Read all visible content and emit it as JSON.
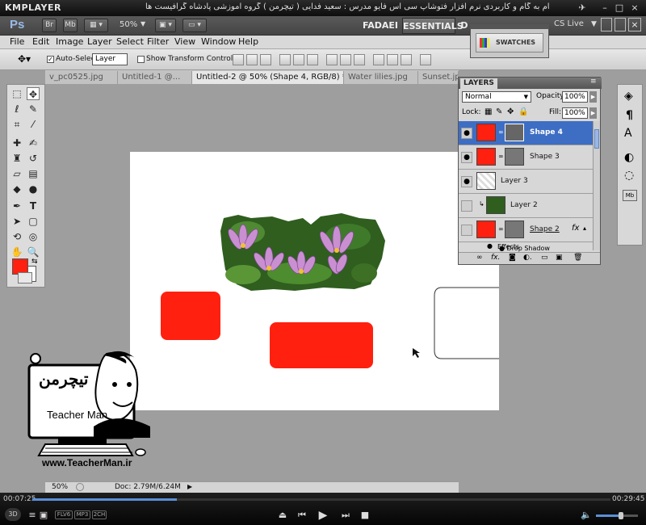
{
  "km_title": {
    "logo": "KMPLAYER",
    "text": "مجموعه آموزشی جامع ، گام به گام و کاربردی نرم افزار فتوشاپ سی اس فایو  مدرس : سعید فدایی ( تیچرمن ) گروه آموزشی پادشاه گرافیست ها",
    "pin": "✈",
    "minimize": "–",
    "maximize": "□",
    "close": "×"
  },
  "appbar": {
    "logo": "Ps",
    "br": "Br",
    "mb": "Mb",
    "zoom": "50%",
    "workspaces": [
      "FADAEI",
      "ESSENTIALS",
      "D"
    ],
    "cs_live": "CS Live"
  },
  "menu": [
    "File",
    "Edit",
    "Image",
    "Layer",
    "Select",
    "Filter",
    "View",
    "Window",
    "Help"
  ],
  "options": {
    "auto_select_label": "Auto-Select:",
    "auto_select_value": "Layer",
    "show_transform": "Show Transform Controls"
  },
  "doc_tabs": [
    {
      "label": "v_pc0525.jpg",
      "active": false
    },
    {
      "label": "Untitled-1 @...",
      "active": false
    },
    {
      "label": "Untitled-2 @ 50% (Shape 4, RGB/8) *",
      "active": true
    },
    {
      "label": "Water lilies.jpg",
      "active": false
    },
    {
      "label": "Sunset.jpg",
      "active": false
    }
  ],
  "swatches": {
    "label": "SWATCHES"
  },
  "layers": {
    "title": "LAYERS",
    "blend_mode": "Normal",
    "opacity_label": "Opacity:",
    "opacity": "100%",
    "lock_label": "Lock:",
    "fill_label": "Fill:",
    "fill": "100%",
    "rows": [
      {
        "name": "Shape 4",
        "selected": true
      },
      {
        "name": "Shape 3",
        "selected": false
      },
      {
        "name": "Layer 3",
        "selected": false
      },
      {
        "name": "Layer 2",
        "selected": false
      },
      {
        "name": "Shape 2",
        "selected": false
      }
    ],
    "effects": "Effects",
    "drop_shadow": "Drop Shadow"
  },
  "status": {
    "zoom": "50%",
    "doc": "Doc: 2.79M/6.24M"
  },
  "player": {
    "elapsed": "00:07:25",
    "total": "00:29:45",
    "progress": 0.25,
    "badges": [
      "FLV6",
      "MP3",
      "2CH"
    ]
  },
  "watermark": {
    "brand_en": "Teacher Man",
    "website": "www.TeacherMan.ir"
  },
  "colors": {
    "foreground": "#ff2010",
    "shape_red": "#ff2010",
    "selection": "#3d6ec4"
  }
}
